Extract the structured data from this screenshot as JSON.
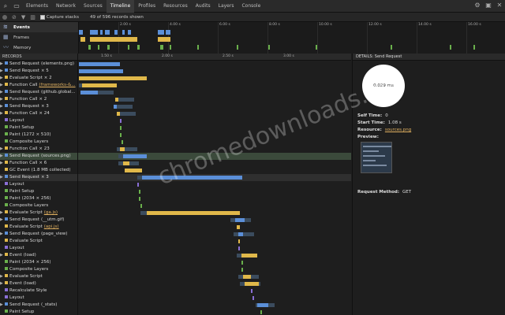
{
  "tabs": [
    "Elements",
    "Network",
    "Sources",
    "Timeline",
    "Profiles",
    "Resources",
    "Audits",
    "Layers",
    "Console"
  ],
  "active_tab": "Timeline",
  "toolbar": {
    "capture_label": "Capture stacks",
    "record_count": "49 of 596 records shown"
  },
  "overview": {
    "items": [
      {
        "label": "Events",
        "icon": "events-icon"
      },
      {
        "label": "Frames",
        "icon": "frames-icon"
      },
      {
        "label": "Memory",
        "icon": "memory-icon"
      }
    ],
    "ticks": [
      "2.00 s",
      "4.00 s",
      "6.00 s",
      "8.00 s",
      "10.00 s",
      "12.00 s",
      "14.00 s",
      "16.00 s"
    ]
  },
  "records_header": {
    "label": "RECORDS",
    "ticks": [
      "1.50 s",
      "2.00 s",
      "2.50 s",
      "3.00 s"
    ]
  },
  "colors": {
    "loading": "#5b8fd8",
    "scripting": "#e0b84a",
    "rendering": "#8a6fd6",
    "painting": "#6ab04c",
    "gc": "#e0b84a"
  },
  "records": [
    {
      "label": "Send Request",
      "detail": "(elements.png)",
      "cat": "loading",
      "expand": true
    },
    {
      "label": "Send Request",
      "detail": "× 5",
      "cat": "loading",
      "expand": true
    },
    {
      "label": "Evaluate Script",
      "detail": "× 2",
      "cat": "scripting",
      "expand": true
    },
    {
      "label": "Function Call",
      "detail": "(frameworks-&...",
      "cat": "scripting",
      "expand": true,
      "link": true
    },
    {
      "label": "Send Request",
      "detail": "(github.global...",
      "cat": "loading",
      "expand": true
    },
    {
      "label": "Function Call",
      "detail": "× 2",
      "cat": "scripting",
      "expand": true
    },
    {
      "label": "Send Request",
      "detail": "× 3",
      "cat": "loading",
      "expand": true
    },
    {
      "label": "Function Call",
      "detail": "× 24",
      "cat": "scripting",
      "expand": true
    },
    {
      "label": "Layout",
      "detail": "",
      "cat": "rendering",
      "expand": false
    },
    {
      "label": "Paint Setup",
      "detail": "",
      "cat": "painting",
      "expand": false
    },
    {
      "label": "Paint",
      "detail": "(1272 × 510)",
      "cat": "painting",
      "expand": false
    },
    {
      "label": "Composite Layers",
      "detail": "",
      "cat": "painting",
      "expand": false
    },
    {
      "label": "Function Call",
      "detail": "× 23",
      "cat": "scripting",
      "expand": true
    },
    {
      "label": "Send Request",
      "detail": "(sources.png)",
      "cat": "loading",
      "expand": true,
      "hl": true
    },
    {
      "label": "Function Call",
      "detail": "× 6",
      "cat": "scripting",
      "expand": true
    },
    {
      "label": "GC Event",
      "detail": "(1.8 MB collected)",
      "cat": "gc",
      "expand": false
    },
    {
      "label": "Send Request",
      "detail": "× 3",
      "cat": "loading",
      "expand": true,
      "hl2": true
    },
    {
      "label": "Layout",
      "detail": "",
      "cat": "rendering",
      "expand": false
    },
    {
      "label": "Paint Setup",
      "detail": "",
      "cat": "painting",
      "expand": false
    },
    {
      "label": "Paint",
      "detail": "(2034 × 256)",
      "cat": "painting",
      "expand": false
    },
    {
      "label": "Composite Layers",
      "detail": "",
      "cat": "painting",
      "expand": false
    },
    {
      "label": "Evaluate Script",
      "detail": "(ga.js)",
      "cat": "scripting",
      "expand": true,
      "link": true
    },
    {
      "label": "Send Request",
      "detail": "(__utm.gif)",
      "cat": "loading",
      "expand": true
    },
    {
      "label": "Evaluate Script",
      "detail": "(api.js)",
      "cat": "scripting",
      "expand": false,
      "link": true
    },
    {
      "label": "Send Request",
      "detail": "(page_view)",
      "cat": "loading",
      "expand": true
    },
    {
      "label": "Evaluate Script",
      "detail": "",
      "cat": "scripting",
      "expand": false
    },
    {
      "label": "Layout",
      "detail": "",
      "cat": "rendering",
      "expand": false
    },
    {
      "label": "Event",
      "detail": "(load)",
      "cat": "scripting",
      "expand": true
    },
    {
      "label": "Paint",
      "detail": "(2034 × 256)",
      "cat": "painting",
      "expand": false
    },
    {
      "label": "Composite Layers",
      "detail": "",
      "cat": "painting",
      "expand": false
    },
    {
      "label": "Evaluate Script",
      "detail": "",
      "cat": "scripting",
      "expand": true
    },
    {
      "label": "Event",
      "detail": "(load)",
      "cat": "scripting",
      "expand": true
    },
    {
      "label": "Recalculate Style",
      "detail": "",
      "cat": "rendering",
      "expand": false
    },
    {
      "label": "Layout",
      "detail": "",
      "cat": "rendering",
      "expand": false
    },
    {
      "label": "Send Request",
      "detail": "(_stats)",
      "cat": "loading",
      "expand": true
    },
    {
      "label": "Paint Setup",
      "detail": "",
      "cat": "painting",
      "expand": false
    }
  ],
  "details": {
    "title": "DETAILS: Send Request",
    "pie_label": "0.029 ms",
    "self_time_label": "Self Time:",
    "self_time": "0",
    "start_time_label": "Start Time:",
    "start_time": "1.08 s",
    "resource_label": "Resource:",
    "resource": "sources.png",
    "preview_label": "Preview:",
    "method_label": "Request Method:",
    "method": "GET"
  },
  "watermark": "chromedownloads.net"
}
